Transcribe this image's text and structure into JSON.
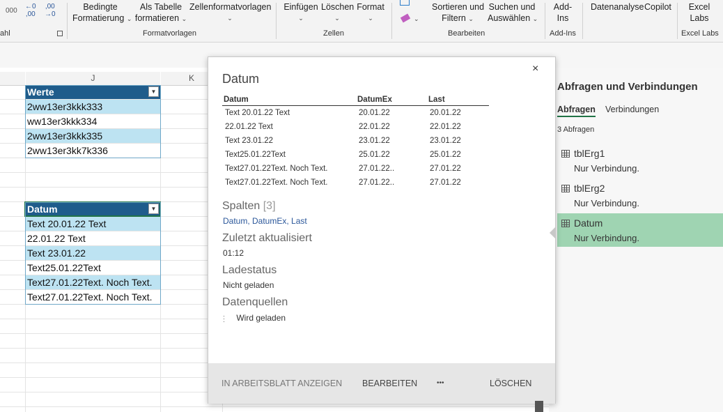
{
  "ribbon": {
    "num_fragment_left": "000",
    "num_dec_increase": "←0\n,00",
    "num_dec_decrease": ",00\n→0",
    "bedingte_line1": "Bedingte",
    "bedingte_line2": "Formatierung",
    "als_tabelle_line1": "Als Tabelle",
    "als_tabelle_line2": "formatieren",
    "zellenformat": "Zellenformatvorlagen",
    "einfuegen": "Einfügen",
    "loeschen": "Löschen",
    "format": "Format",
    "sortieren_line1": "Sortieren und",
    "sortieren_line2": "Filtern",
    "suchen_line1": "Suchen und",
    "suchen_line2": "Auswählen",
    "addins_line1": "Add-",
    "addins_line2": "Ins",
    "datenanalyse": "Datenanalyse",
    "copilot": "Copilot",
    "excel_line1": "Excel",
    "excel_line2": "Labs",
    "groups": {
      "zahl": "ahl",
      "formatvorlagen": "Formatvorlagen",
      "zellen": "Zellen",
      "bearbeiten": "Bearbeiten",
      "addins": "Add-Ins",
      "excellabs": "Excel Labs"
    }
  },
  "columns": {
    "j": "J",
    "k": "K"
  },
  "table_werte": {
    "header": "Werte",
    "rows": [
      "2ww13er3kkk333",
      "ww13er3kkk334",
      "2ww13er3kkk335",
      "2ww13er3kk7k336"
    ]
  },
  "table_datum": {
    "header": "Datum",
    "rows": [
      "Text 20.01.22 Text",
      "22.01.22 Text",
      "Text 23.01.22",
      "Text25.01.22Text",
      "Text27.01.22Text. Noch Text.",
      "Text27.01.22Text. Noch Text."
    ]
  },
  "card": {
    "title": "Datum",
    "close": "×",
    "preview_headers": [
      "Datum",
      "DatumEx",
      "Last"
    ],
    "preview_rows": [
      [
        "Text 20.01.22 Text",
        "20.01.22",
        "20.01.22"
      ],
      [
        "22.01.22 Text",
        "22.01.22",
        "22.01.22"
      ],
      [
        "Text 23.01.22",
        "23.01.22",
        "23.01.22"
      ],
      [
        "Text25.01.22Text",
        "25.01.22",
        "25.01.22"
      ],
      [
        "Text27.01.22Text. Noch Text.",
        "27.01.22..",
        "27.01.22"
      ],
      [
        "Text27.01.22Text. Noch Text.",
        "27.01.22..",
        "27.01.22"
      ]
    ],
    "spalten_label": "Spalten",
    "spalten_count": "[3]",
    "spalten_values": "Datum, DatumEx, Last",
    "updated_label": "Zuletzt aktualisiert",
    "updated_value": "01:12",
    "status_label": "Ladestatus",
    "status_value": "Nicht geladen",
    "sources_label": "Datenquellen",
    "sources_value": "Wird geladen",
    "btn_show": "IN ARBEITSBLATT ANZEIGEN",
    "btn_edit": "BEARBEITEN",
    "btn_more": "•••",
    "btn_delete": "LÖSCHEN"
  },
  "pane": {
    "title": "Abfragen und Verbindungen",
    "tab_queries": "Abfragen",
    "tab_connections": "Verbindungen",
    "count": "3 Abfragen",
    "items": [
      {
        "name": "tblErg1",
        "status": "Nur Verbindung."
      },
      {
        "name": "tblErg2",
        "status": "Nur Verbindung."
      },
      {
        "name": "Datum",
        "status": "Nur Verbindung."
      }
    ]
  }
}
